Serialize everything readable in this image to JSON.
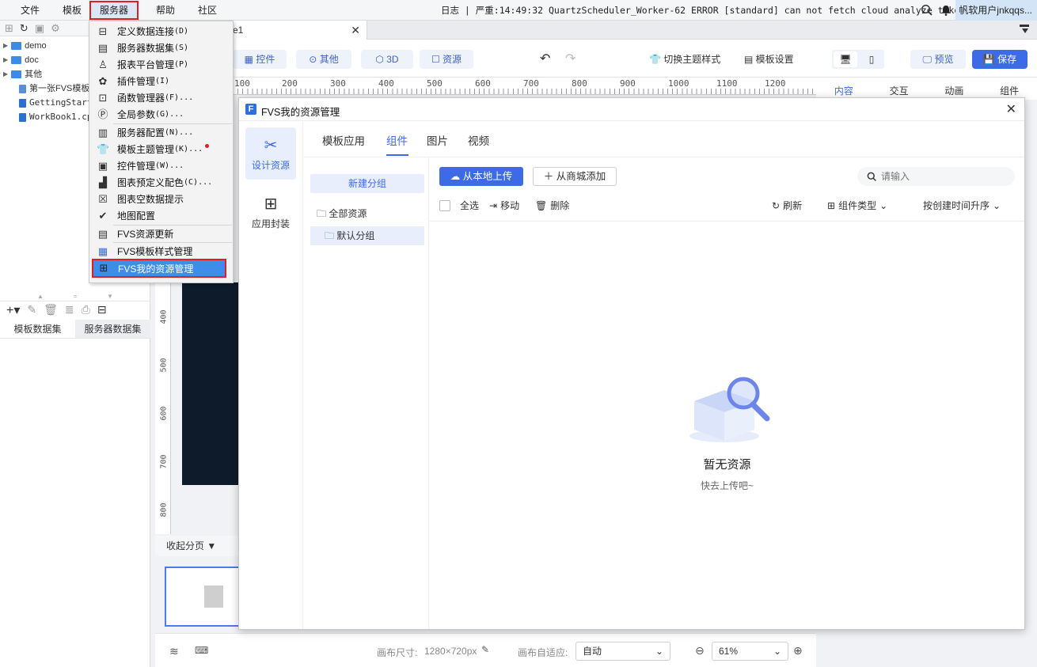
{
  "menubar": {
    "items": [
      "文件",
      "模板",
      "服务器",
      "帮助",
      "社区"
    ],
    "status_log": "日志 | 严重:14:49:32 QuartzScheduler_Worker-62 ERROR [standard] can not fetch cloud analyze token.",
    "user": "帆软用户jnkqqs..."
  },
  "doc_tab": {
    "title": "e1"
  },
  "tree": {
    "items": [
      "demo",
      "doc",
      "其他",
      "第一张FVS模板",
      "GettingStart",
      "WorkBook1.cp"
    ]
  },
  "dataset_tabs": [
    "模板数据集",
    "服务器数据集"
  ],
  "toolbar": {
    "control": "控件",
    "other": "其他",
    "three_d": "3D",
    "resource": "资源",
    "switch_theme": "切换主题样式",
    "template_settings": "模板设置",
    "preview": "预览",
    "save": "保存"
  },
  "right_tabs": [
    "内容",
    "交互",
    "动画",
    "组件"
  ],
  "ruler": {
    "h": [
      "100",
      "200",
      "300",
      "400",
      "500",
      "600",
      "700",
      "800",
      "900",
      "1000",
      "1100",
      "1200"
    ],
    "v": [
      "400",
      "500",
      "600",
      "700",
      "800"
    ]
  },
  "page_collapse": "收起分页",
  "bottom": {
    "canvas_size_label": "画布尺寸:",
    "canvas_size": "1280×720px",
    "adapt_label": "画布自适应:",
    "adapt_value": "自动",
    "zoom": "61%"
  },
  "server_menu": {
    "items": [
      {
        "label": "定义数据连接",
        "shortcut": "(D)"
      },
      {
        "label": "服务器数据集",
        "shortcut": "(S)"
      },
      {
        "label": "报表平台管理",
        "shortcut": "(P)"
      },
      {
        "label": "插件管理",
        "shortcut": "(I)"
      },
      {
        "label": "函数管理器",
        "shortcut": "(F)..."
      },
      {
        "label": "全局参数",
        "shortcut": "(G)..."
      },
      {
        "label": "服务器配置",
        "shortcut": "(N)..."
      },
      {
        "label": "模板主题管理",
        "shortcut": "(K)..."
      },
      {
        "label": "控件管理",
        "shortcut": "(W)..."
      },
      {
        "label": "图表预定义配色",
        "shortcut": "(C)..."
      },
      {
        "label": "图表空数据提示",
        "shortcut": ""
      },
      {
        "label": "地图配置",
        "shortcut": ""
      },
      {
        "label": "FVS资源更新",
        "shortcut": ""
      },
      {
        "label": "FVS模板样式管理",
        "shortcut": ""
      },
      {
        "label": "FVS我的资源管理",
        "shortcut": ""
      }
    ]
  },
  "dialog": {
    "title": "FVS我的资源管理",
    "side": [
      "设计资源",
      "应用封装"
    ],
    "tabs": [
      "模板应用",
      "组件",
      "图片",
      "视频"
    ],
    "new_group": "新建分组",
    "all_resources": "全部资源",
    "default_group": "默认分组",
    "upload": "从本地上传",
    "add_from_store": "从商城添加",
    "search_placeholder": "请输入",
    "select_all": "全选",
    "move": "移动",
    "delete": "删除",
    "refresh": "刷新",
    "component_type": "组件类型",
    "sort": "按创建时间升序",
    "empty_title": "暂无资源",
    "empty_hint": "快去上传吧~"
  },
  "colors": {
    "accent": "#3d6be6",
    "highlight": "#3d8ee8",
    "alert": "#e02020"
  }
}
